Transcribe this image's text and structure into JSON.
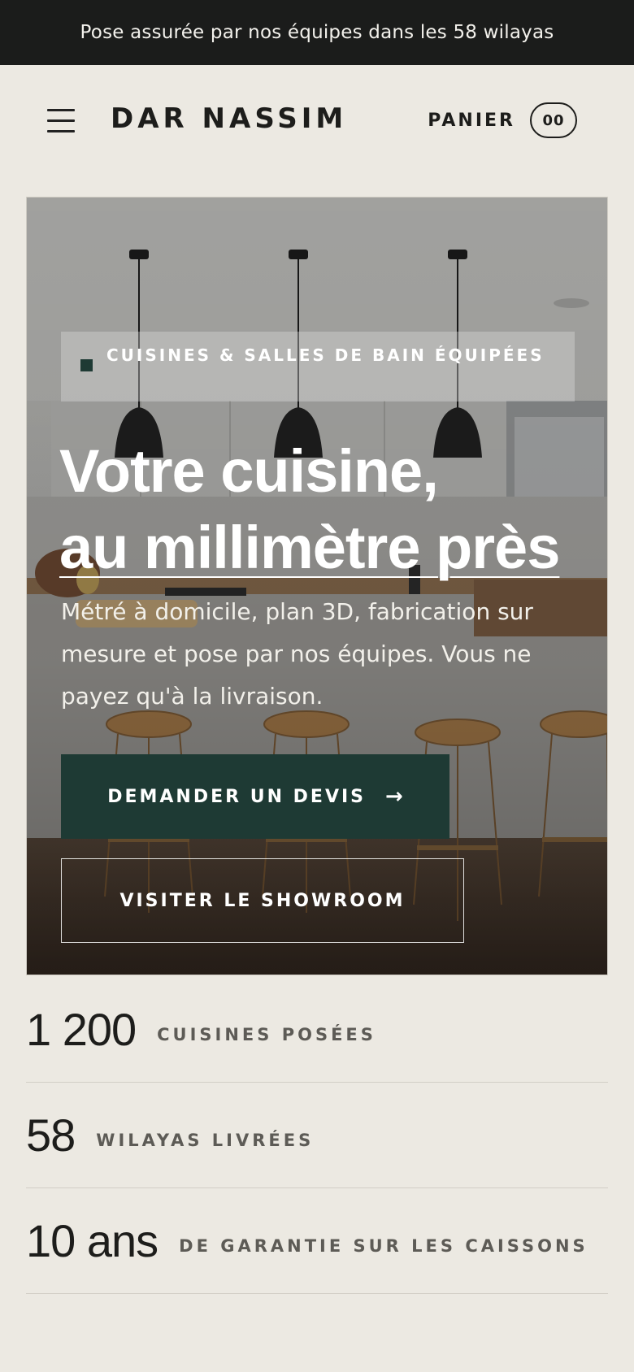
{
  "announcement": {
    "text": "Pose assurée par nos équipes dans les 58 wilayas"
  },
  "header": {
    "logo": "DAR NASSIM",
    "cart_label": "PANIER",
    "cart_count": "00",
    "menu_icon": "hamburger-icon"
  },
  "hero": {
    "tag": "CUISINES & SALLES DE BAIN ÉQUIPÉES",
    "title_line1": "Votre cuisine,",
    "title_line2": "au millimètre près",
    "subtitle": "Métré à domicile, plan 3D, fabrication sur mesure et pose par nos équipes. Vous ne payez qu'à la livraison.",
    "primary_button": "DEMANDER UN DEVIS",
    "primary_icon": "arrow-right-icon",
    "secondary_button": "VISITER LE SHOWROOM",
    "colors": {
      "accent": "#1e3a34"
    }
  },
  "stats": [
    {
      "value": "1 200",
      "label": "CUISINES POSÉES"
    },
    {
      "value": "58",
      "label": "WILAYAS LIVRÉES"
    },
    {
      "value": "10 ans",
      "label": "DE GARANTIE SUR LES CAISSONS"
    }
  ]
}
